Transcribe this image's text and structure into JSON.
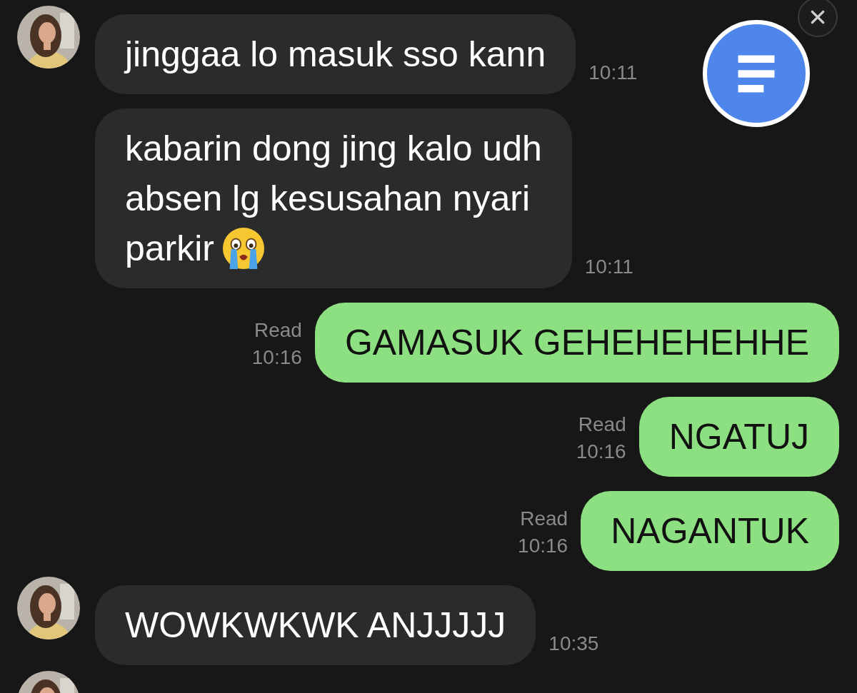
{
  "messages": [
    {
      "kind": "incoming",
      "avatar": true,
      "lines": [
        "jinggaa lo masuk sso kann"
      ],
      "emoji": false,
      "time": "10:11"
    },
    {
      "kind": "incoming",
      "avatar": false,
      "lines": [
        "kabarin dong jing kalo udh",
        "absen lg kesusahan nyari",
        "parkir"
      ],
      "emoji": true,
      "time": "10:11"
    },
    {
      "kind": "outgoing",
      "lines": [
        "GAMASUK GEHEHEHEHHE"
      ],
      "read": "Read",
      "time": "10:16"
    },
    {
      "kind": "outgoing",
      "lines": [
        "NGATUJ"
      ],
      "read": "Read",
      "time": "10:16"
    },
    {
      "kind": "outgoing",
      "lines": [
        "NAGANTUK"
      ],
      "read": "Read",
      "time": "10:16"
    },
    {
      "kind": "incoming",
      "avatar": true,
      "lines": [
        "WOWKWKWK ANJJJJJ"
      ],
      "emoji": false,
      "time": "10:35"
    },
    {
      "kind": "incoming",
      "avatar": true
    }
  ]
}
